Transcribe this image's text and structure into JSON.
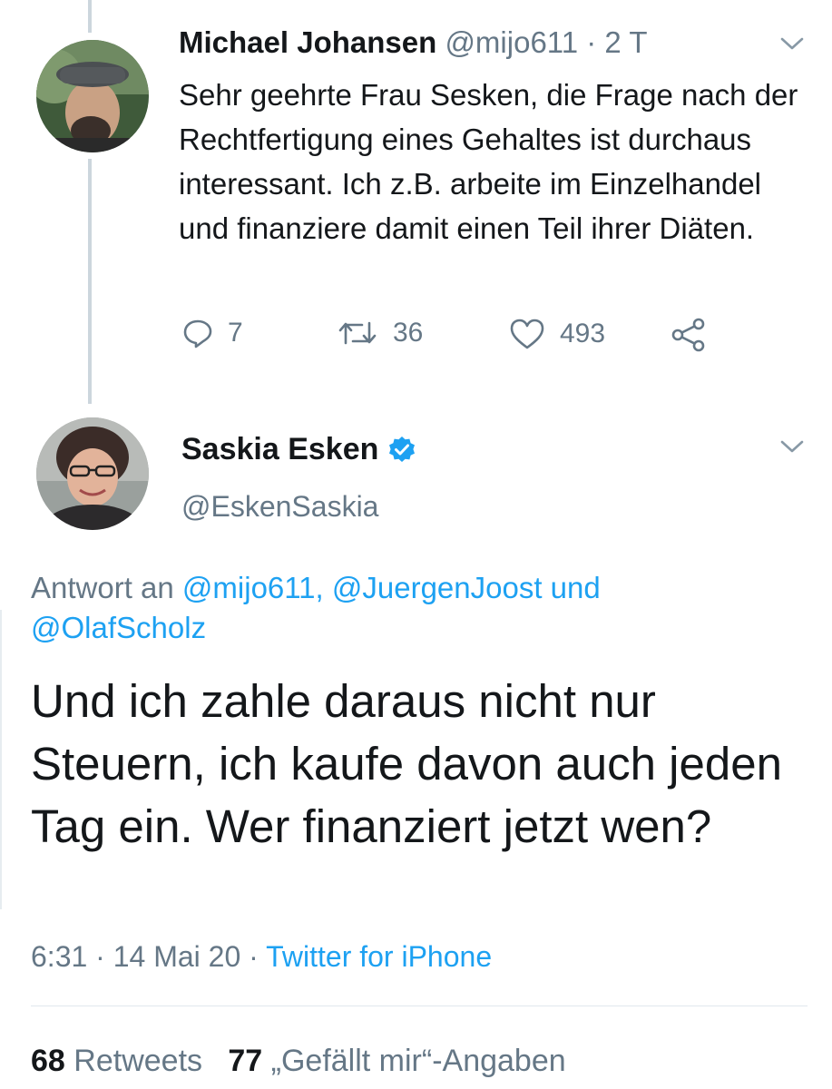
{
  "parent_tweet": {
    "display_name": "Michael Johansen",
    "handle": "@mijo611",
    "separator": " · ",
    "time_ago": "2 T",
    "text": "Sehr geehrte Frau Sesken, die Frage nach der Rechtfertigung eines Gehaltes ist durchaus interessant. Ich z.B. arbeite im Einzelhandel und finanziere damit einen Teil ihrer Diäten.",
    "reply_count": "7",
    "retweet_count": "36",
    "like_count": "493",
    "icons": [
      "reply-icon",
      "retweet-icon",
      "like-icon",
      "share-icon",
      "chevron-down-icon"
    ]
  },
  "main_tweet": {
    "display_name": "Saskia Esken",
    "handle": "@EskenSaskia",
    "reply_prefix": "Antwort an ",
    "reply_mentions_1": "@mijo611, @JuergenJoost",
    "reply_conjunction": " und",
    "reply_mentions_2": "@OlafScholz",
    "text": "Und ich zahle daraus nicht nur Steuern, ich kaufe davon auch jeden Tag ein. Wer finanziert jetzt wen?",
    "time": "6:31",
    "separator1": " · ",
    "date": "14 Mai 20",
    "separator2": " · ",
    "source": "Twitter for iPhone",
    "retweets_count": "68",
    "retweets_label": "Retweets",
    "likes_count": "77",
    "likes_label": "„Gefällt mir“-Angaben",
    "icons": [
      "verified-badge-icon",
      "chevron-down-icon"
    ]
  },
  "colors": {
    "accent": "#1da1f2",
    "muted_text": "#657786",
    "primary_text": "#14171a",
    "divider": "#e1e8ed"
  }
}
